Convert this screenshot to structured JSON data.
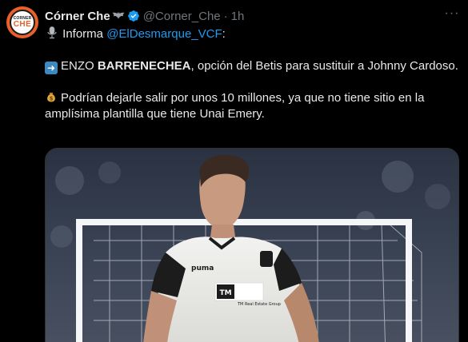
{
  "tweet": {
    "author": {
      "name": "Córner Che",
      "handle": "@Corner_Che",
      "time": "1h",
      "avatar_text_top": "CORNER",
      "avatar_text_main": "CHE",
      "name_emoji_icon": "bat-icon",
      "verified_icon": "verified-badge-icon"
    },
    "more_label": "···",
    "lines": {
      "informa_prefix": " Informa ",
      "informa_mention": "@ElDesmarque_VCF",
      "informa_suffix": ":",
      "p1_prefix": "ENZO ",
      "p1_bold": "BARRENECHEA",
      "p1_rest": ", opción del Betis para sustituir a Johnny Cardoso.",
      "p2_text": "Podrían dejarle salir por unos 10 millones, ya que no tiene sitio en la amplísima plantilla que tiene Unai Emery."
    },
    "media": {
      "shirt_sponsor_badge": "TM",
      "shirt_sponsor_text": "TM Real Estate Group",
      "shirt_brand": "puma"
    },
    "colors": {
      "background": "#000000",
      "text": "#e7e9ea",
      "muted": "#71767b",
      "link": "#1d9bf0",
      "verified": "#1d9bf0",
      "avatar_bg": "#e8612c"
    }
  }
}
